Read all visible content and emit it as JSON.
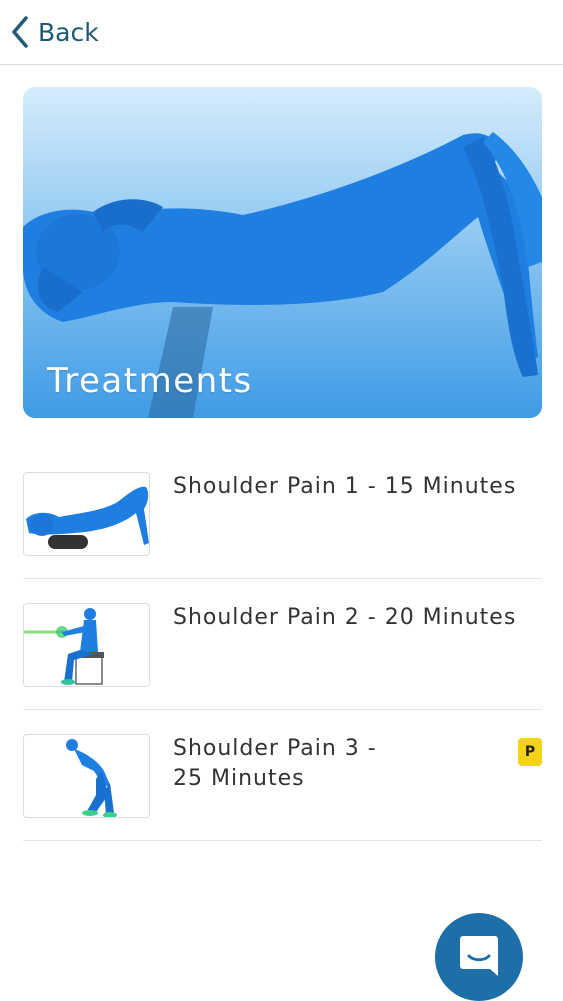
{
  "nav": {
    "back_label": "Back"
  },
  "hero": {
    "title": "Treatments"
  },
  "treatments": [
    {
      "title": "Shoulder Pain 1 - 15 Minutes",
      "premium_badge": ""
    },
    {
      "title": "Shoulder Pain 2 - 20 Minutes",
      "premium_badge": ""
    },
    {
      "title": "Shoulder Pain 3 - 25 Minutes",
      "premium_badge": "P"
    }
  ],
  "colors": {
    "accent": "#1f5873",
    "figure_blue": "#1f7fe0",
    "chat_button": "#1e6fa8",
    "badge_yellow": "#f4d21a"
  },
  "icons": {
    "back": "chevron-left-icon",
    "chat": "chat-bubble-icon"
  }
}
